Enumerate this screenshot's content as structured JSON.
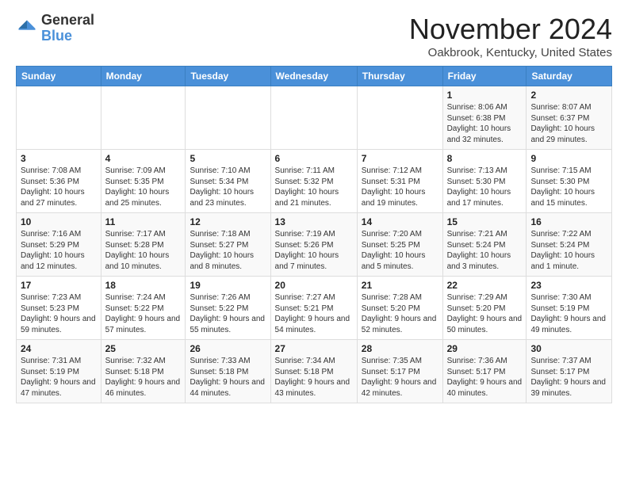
{
  "header": {
    "logo_general": "General",
    "logo_blue": "Blue",
    "month_title": "November 2024",
    "location": "Oakbrook, Kentucky, United States"
  },
  "days_of_week": [
    "Sunday",
    "Monday",
    "Tuesday",
    "Wednesday",
    "Thursday",
    "Friday",
    "Saturday"
  ],
  "weeks": [
    [
      {
        "day": "",
        "info": ""
      },
      {
        "day": "",
        "info": ""
      },
      {
        "day": "",
        "info": ""
      },
      {
        "day": "",
        "info": ""
      },
      {
        "day": "",
        "info": ""
      },
      {
        "day": "1",
        "info": "Sunrise: 8:06 AM\nSunset: 6:38 PM\nDaylight: 10 hours and 32 minutes."
      },
      {
        "day": "2",
        "info": "Sunrise: 8:07 AM\nSunset: 6:37 PM\nDaylight: 10 hours and 29 minutes."
      }
    ],
    [
      {
        "day": "3",
        "info": "Sunrise: 7:08 AM\nSunset: 5:36 PM\nDaylight: 10 hours and 27 minutes."
      },
      {
        "day": "4",
        "info": "Sunrise: 7:09 AM\nSunset: 5:35 PM\nDaylight: 10 hours and 25 minutes."
      },
      {
        "day": "5",
        "info": "Sunrise: 7:10 AM\nSunset: 5:34 PM\nDaylight: 10 hours and 23 minutes."
      },
      {
        "day": "6",
        "info": "Sunrise: 7:11 AM\nSunset: 5:32 PM\nDaylight: 10 hours and 21 minutes."
      },
      {
        "day": "7",
        "info": "Sunrise: 7:12 AM\nSunset: 5:31 PM\nDaylight: 10 hours and 19 minutes."
      },
      {
        "day": "8",
        "info": "Sunrise: 7:13 AM\nSunset: 5:30 PM\nDaylight: 10 hours and 17 minutes."
      },
      {
        "day": "9",
        "info": "Sunrise: 7:15 AM\nSunset: 5:30 PM\nDaylight: 10 hours and 15 minutes."
      }
    ],
    [
      {
        "day": "10",
        "info": "Sunrise: 7:16 AM\nSunset: 5:29 PM\nDaylight: 10 hours and 12 minutes."
      },
      {
        "day": "11",
        "info": "Sunrise: 7:17 AM\nSunset: 5:28 PM\nDaylight: 10 hours and 10 minutes."
      },
      {
        "day": "12",
        "info": "Sunrise: 7:18 AM\nSunset: 5:27 PM\nDaylight: 10 hours and 8 minutes."
      },
      {
        "day": "13",
        "info": "Sunrise: 7:19 AM\nSunset: 5:26 PM\nDaylight: 10 hours and 7 minutes."
      },
      {
        "day": "14",
        "info": "Sunrise: 7:20 AM\nSunset: 5:25 PM\nDaylight: 10 hours and 5 minutes."
      },
      {
        "day": "15",
        "info": "Sunrise: 7:21 AM\nSunset: 5:24 PM\nDaylight: 10 hours and 3 minutes."
      },
      {
        "day": "16",
        "info": "Sunrise: 7:22 AM\nSunset: 5:24 PM\nDaylight: 10 hours and 1 minute."
      }
    ],
    [
      {
        "day": "17",
        "info": "Sunrise: 7:23 AM\nSunset: 5:23 PM\nDaylight: 9 hours and 59 minutes."
      },
      {
        "day": "18",
        "info": "Sunrise: 7:24 AM\nSunset: 5:22 PM\nDaylight: 9 hours and 57 minutes."
      },
      {
        "day": "19",
        "info": "Sunrise: 7:26 AM\nSunset: 5:22 PM\nDaylight: 9 hours and 55 minutes."
      },
      {
        "day": "20",
        "info": "Sunrise: 7:27 AM\nSunset: 5:21 PM\nDaylight: 9 hours and 54 minutes."
      },
      {
        "day": "21",
        "info": "Sunrise: 7:28 AM\nSunset: 5:20 PM\nDaylight: 9 hours and 52 minutes."
      },
      {
        "day": "22",
        "info": "Sunrise: 7:29 AM\nSunset: 5:20 PM\nDaylight: 9 hours and 50 minutes."
      },
      {
        "day": "23",
        "info": "Sunrise: 7:30 AM\nSunset: 5:19 PM\nDaylight: 9 hours and 49 minutes."
      }
    ],
    [
      {
        "day": "24",
        "info": "Sunrise: 7:31 AM\nSunset: 5:19 PM\nDaylight: 9 hours and 47 minutes."
      },
      {
        "day": "25",
        "info": "Sunrise: 7:32 AM\nSunset: 5:18 PM\nDaylight: 9 hours and 46 minutes."
      },
      {
        "day": "26",
        "info": "Sunrise: 7:33 AM\nSunset: 5:18 PM\nDaylight: 9 hours and 44 minutes."
      },
      {
        "day": "27",
        "info": "Sunrise: 7:34 AM\nSunset: 5:18 PM\nDaylight: 9 hours and 43 minutes."
      },
      {
        "day": "28",
        "info": "Sunrise: 7:35 AM\nSunset: 5:17 PM\nDaylight: 9 hours and 42 minutes."
      },
      {
        "day": "29",
        "info": "Sunrise: 7:36 AM\nSunset: 5:17 PM\nDaylight: 9 hours and 40 minutes."
      },
      {
        "day": "30",
        "info": "Sunrise: 7:37 AM\nSunset: 5:17 PM\nDaylight: 9 hours and 39 minutes."
      }
    ]
  ]
}
